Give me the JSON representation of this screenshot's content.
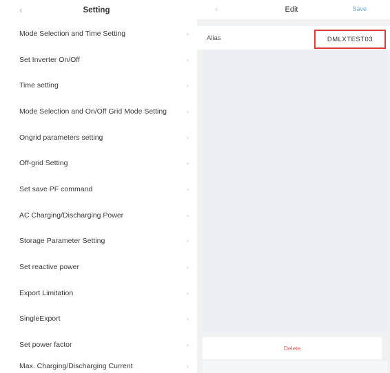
{
  "setting_screen": {
    "title": "Setting",
    "back_icon": "chevron-left-icon",
    "items": [
      {
        "label": "Mode Selection and Time Setting"
      },
      {
        "label": "Set Inverter On/Off"
      },
      {
        "label": "Time setting"
      },
      {
        "label": "Mode Selection and On/Off Grid Mode Setting"
      },
      {
        "label": "Ongrid parameters setting"
      },
      {
        "label": "Off-grid Setting"
      },
      {
        "label": "Set save PF command"
      },
      {
        "label": "AC Charging/Discharging Power"
      },
      {
        "label": "Storage Parameter Setting"
      },
      {
        "label": "Set reactive power"
      },
      {
        "label": "Export Limitation"
      },
      {
        "label": "SingleExport"
      },
      {
        "label": "Set power factor"
      },
      {
        "label": "Max. Charging/Discharging Current"
      }
    ],
    "chevron": "›"
  },
  "edit_screen": {
    "title": "Edit",
    "save_label": "Save",
    "field": {
      "label": "Alias",
      "value": "DMLXTEST03"
    },
    "delete_label": "Delete",
    "highlight_color": "#e03b3b",
    "accent_color": "#6fa8e0"
  }
}
